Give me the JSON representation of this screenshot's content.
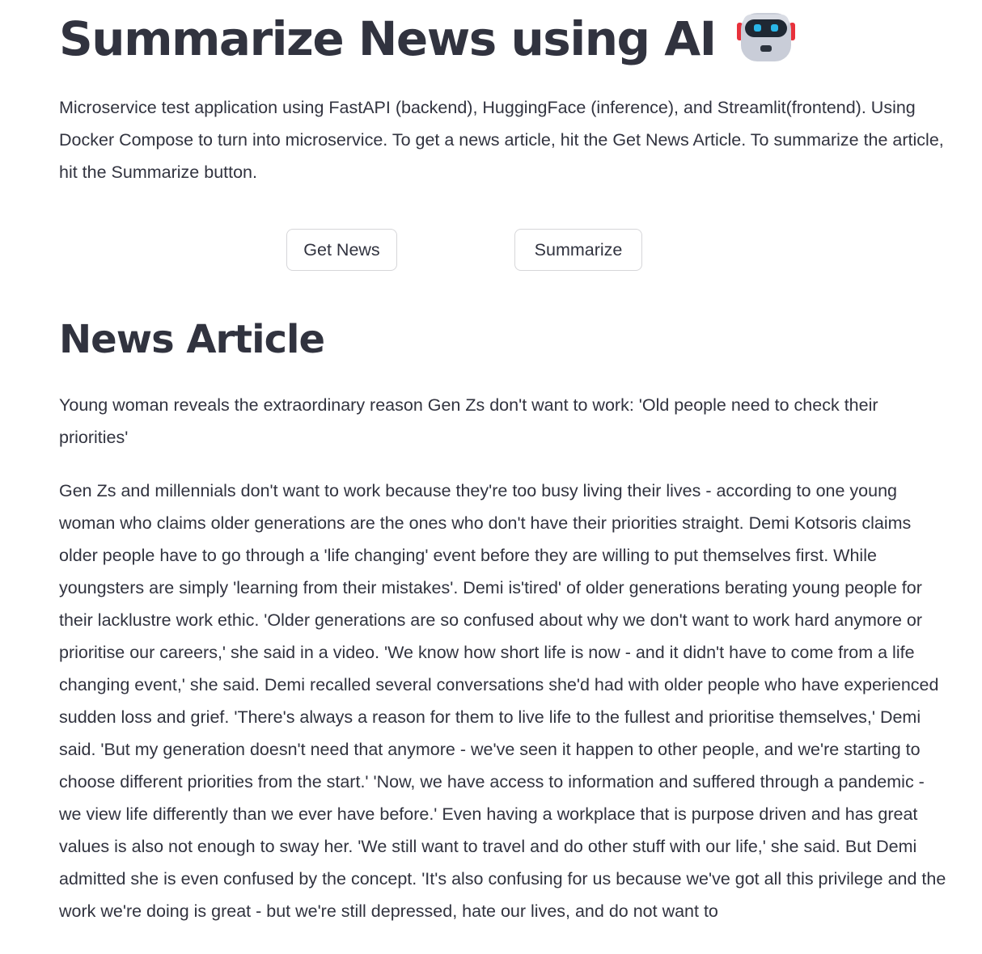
{
  "header": {
    "title": "Summarize News using AI",
    "title_icon": "robot-icon",
    "description": "Microservice test application using FastAPI (backend), HuggingFace (inference), and Streamlit(frontend). Using Docker Compose to turn into microservice. To get a news article, hit the Get News Article. To summarize the article, hit the Summarize button."
  },
  "actions": {
    "get_news_label": "Get News",
    "summarize_label": "Summarize"
  },
  "article": {
    "section_title": "News Article",
    "headline": "Young woman reveals the extraordinary reason Gen Zs don't want to work: 'Old people need to check their priorities'",
    "body": "Gen Zs and millennials don't want to work because they're too busy living their lives - according to one young woman who claims older generations are the ones who don't have their priorities straight. Demi Kotsoris claims older people have to go through a 'life changing' event before they are willing to put themselves first. While youngsters are simply 'learning from their mistakes'. Demi is'tired' of older generations berating young people for their lacklustre work ethic. 'Older generations are so confused about why we don't want to work hard anymore or prioritise our careers,' she said in a video. 'We know how short life is now - and it didn't have to come from a life changing event,' she said. Demi recalled several conversations she'd had with older people who have experienced sudden loss and grief. 'There's always a reason for them to live life to the fullest and prioritise themselves,' Demi said. 'But my generation doesn't need that anymore - we've seen it happen to other people, and we're starting to choose different priorities from the start.' 'Now, we have access to information and suffered through a pandemic - we view life differently than we ever have before.' Even having a workplace that is purpose driven and has great values is also not enough to sway her. 'We still want to travel and do other stuff with our life,' she said. But Demi admitted she is even confused by the concept. 'It's also confusing for us because we've got all this privilege and the work we're doing is great - but we're still depressed, hate our lives, and do not want to"
  },
  "colors": {
    "text": "#31333f",
    "button_border": "#d6d6d9",
    "background": "#ffffff"
  }
}
